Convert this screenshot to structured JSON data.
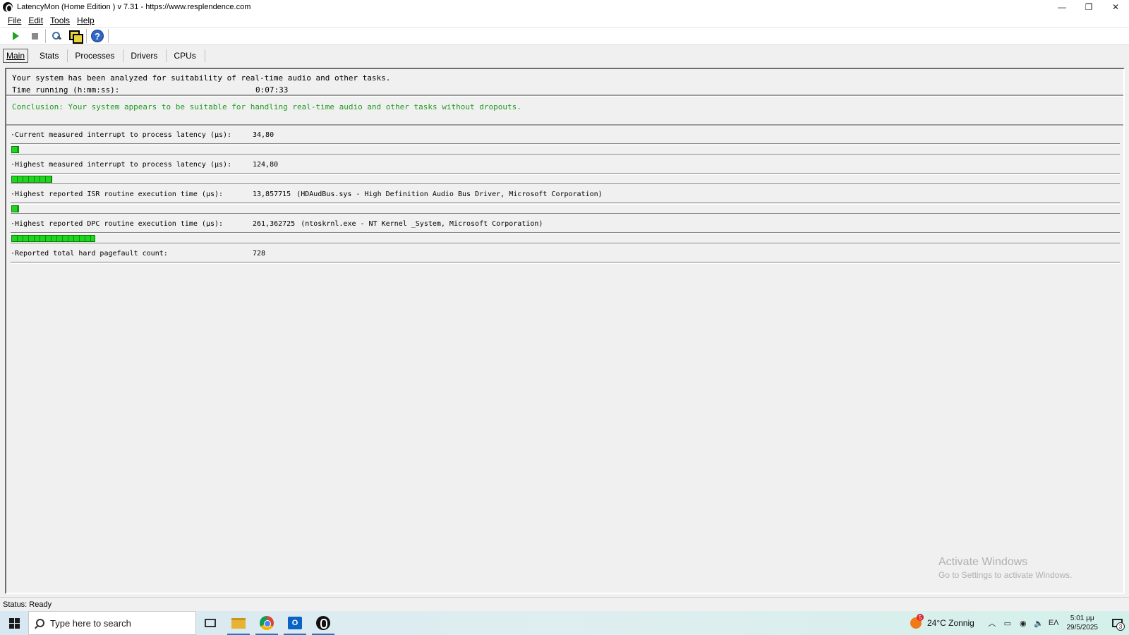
{
  "window": {
    "title": "LatencyMon  (Home Edition )  v 7.31 - https://www.resplendence.com",
    "minimize": "—",
    "restore": "❐",
    "close": "✕"
  },
  "menu": [
    {
      "label": "File"
    },
    {
      "label": "Edit"
    },
    {
      "label": "Tools"
    },
    {
      "label": "Help"
    }
  ],
  "toolbar": {
    "icons": [
      "play-icon",
      "stop-icon",
      "tools-icon",
      "copy-icon",
      "help-icon"
    ],
    "help_glyph": "?"
  },
  "tabs": [
    {
      "label": "Main"
    },
    {
      "label": "Stats"
    },
    {
      "label": "Processes"
    },
    {
      "label": "Drivers"
    },
    {
      "label": "CPUs"
    }
  ],
  "summary": {
    "analyzed": "Your system has been analyzed for suitability of real-time audio and other tasks.",
    "time_label": "Time running (h:mm:ss):",
    "time_value": "0:07:33",
    "conclusion": "Conclusion: Your system appears to be suitable for handling real-time audio and other tasks without dropouts."
  },
  "metrics": [
    {
      "label": "·Current measured interrupt to process latency (µs):",
      "value": "34,80",
      "desc": "",
      "level": 0.007
    },
    {
      "label": "·Highest measured interrupt to process latency (µs):",
      "value": "124,80",
      "desc": "",
      "level": 0.037
    },
    {
      "label": "·Highest reported ISR routine execution time (µs):",
      "value": "13,857715",
      "desc": "(HDAudBus.sys - High Definition Audio Bus Driver, Microsoft Corporation)",
      "level": 0.007
    },
    {
      "label": "·Highest reported DPC routine execution time (µs):",
      "value": "261,362725",
      "desc": "(ntoskrnl.exe - NT Kernel _System, Microsoft Corporation)",
      "level": 0.076
    },
    {
      "label": "·Reported total hard pagefault count:",
      "value": "728",
      "desc": ""
    }
  ],
  "watermark": {
    "line1": "Activate Windows",
    "line2": "Go to Settings to activate Windows."
  },
  "status": "Status: Ready",
  "taskbar": {
    "search_placeholder": "Type here to search",
    "weather_badge": "5",
    "weather": "24°C  Zonnig",
    "lang": "ΕΛ",
    "time": "5:01 μμ",
    "date": "29/5/2025",
    "notifications": "3",
    "colors": {
      "accent": "#2f6fbf"
    }
  }
}
